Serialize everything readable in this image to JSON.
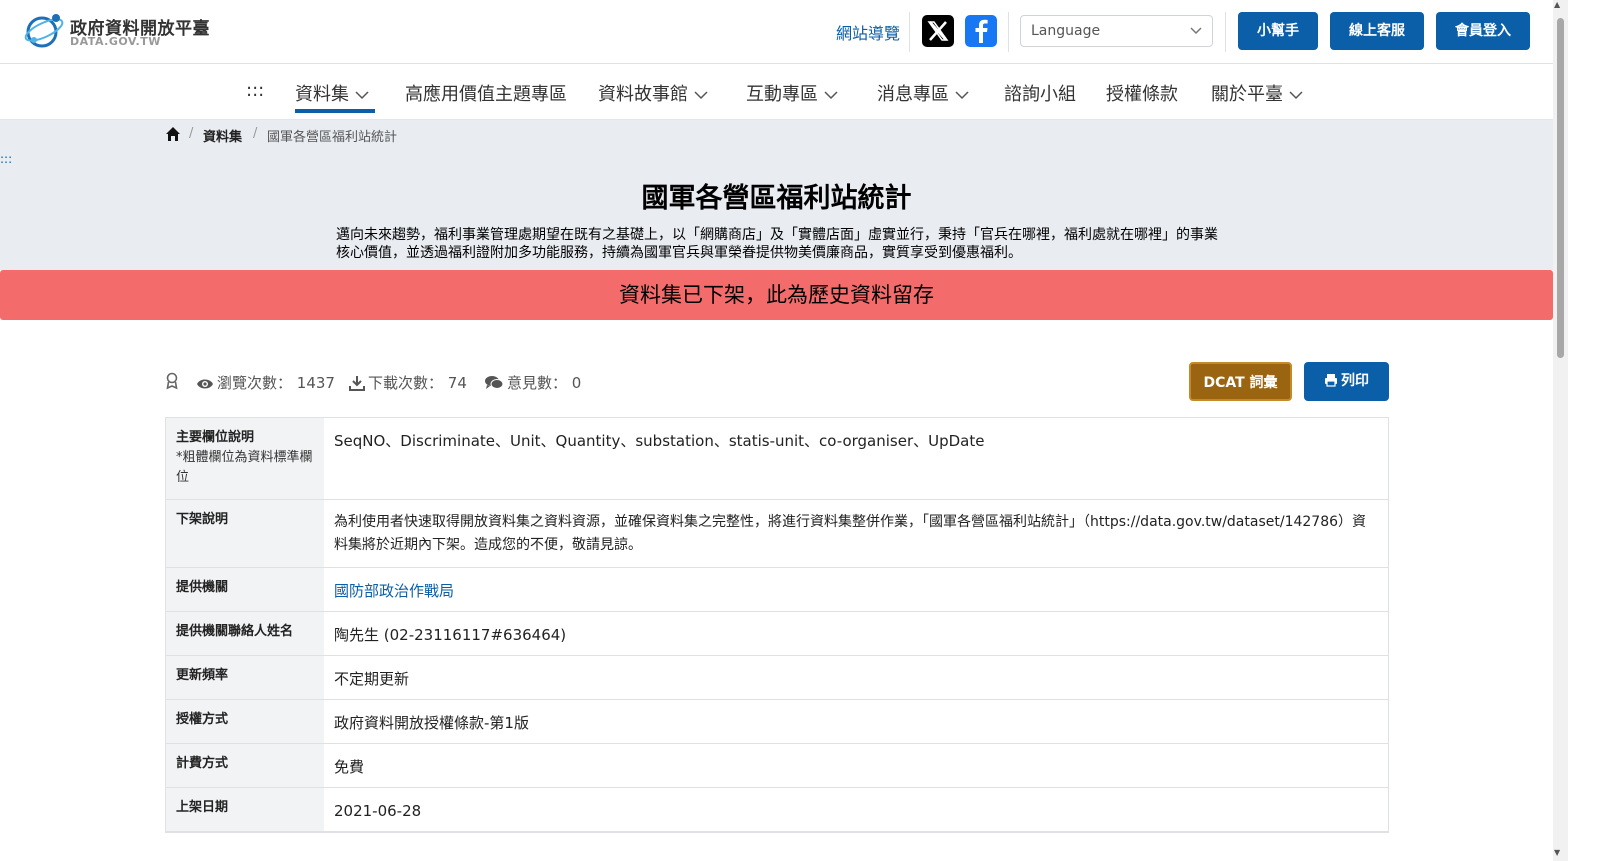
{
  "header": {
    "logo_cn": "政府資料開放平臺",
    "logo_en": "DATA.GOV.TW",
    "sitemap": "網站導覽",
    "language_placeholder": "Language",
    "buttons": [
      "小幫手",
      "線上客服",
      "會員登入"
    ]
  },
  "nav": {
    "menu_dots": ":::",
    "items": [
      {
        "label": "資料集",
        "dropdown": true
      },
      {
        "label": "高應用價值主題專區",
        "dropdown": false
      },
      {
        "label": "資料故事館",
        "dropdown": true
      },
      {
        "label": "互動專區",
        "dropdown": true
      },
      {
        "label": "消息專區",
        "dropdown": true
      },
      {
        "label": "諮詢小組",
        "dropdown": false
      },
      {
        "label": "授權條款",
        "dropdown": false
      },
      {
        "label": "關於平臺",
        "dropdown": true
      }
    ]
  },
  "breadcrumb": {
    "section": "資料集",
    "current": "國軍各營區福利站統計"
  },
  "side_dots": ":::",
  "page": {
    "title": "國軍各營區福利站統計",
    "description": "邁向未來趨勢，福利事業管理處期望在既有之基礎上，以「網購商店」及「實體店面」虛實並行，秉持「官兵在哪裡，福利處就在哪裡」的事業核心價值，並透過福利證附加多功能服務，持續為國軍官兵與軍榮眷提供物美價廉商品，實質享受到優惠福利。",
    "removed_notice": "資料集已下架，此為歷史資料留存"
  },
  "stats": {
    "views_label": "瀏覽次數：",
    "views": "1437",
    "downloads_label": "下載次數：",
    "downloads": "74",
    "comments_label": "意見數：",
    "comments": "0"
  },
  "actions": {
    "dcat": "DCAT 詞彙",
    "print": "列印"
  },
  "metadata": [
    {
      "key": "主要欄位說明",
      "sub": "*粗體欄位為資料標準欄位",
      "value": "SeqNO、Discriminate、Unit、Quantity、substation、statis-unit、co-organiser、UpDate"
    },
    {
      "key": "下架說明",
      "value": "為利使用者快速取得開放資料集之資料資源，並確保資料集之完整性，將進行資料集整併作業，「國軍各營區福利站統計」（https://data.gov.tw/dataset/142786）資料集將於近期內下架。造成您的不便，敬請見諒。"
    },
    {
      "key": "提供機關",
      "value": "國防部政治作戰局",
      "link": true
    },
    {
      "key": "提供機關聯絡人姓名",
      "value": "陶先生 (02-23116117#636464)"
    },
    {
      "key": "更新頻率",
      "value": "不定期更新"
    },
    {
      "key": "授權方式",
      "value": "政府資料開放授權條款-第1版"
    },
    {
      "key": "計費方式",
      "value": "免費"
    },
    {
      "key": "上架日期",
      "value": "2021-06-28"
    }
  ],
  "colors": {
    "primary": "#0b5ea8",
    "dcat": "#9b6410",
    "removed_banner": "#f46b6b",
    "hero_bg": "#e9edf2"
  }
}
